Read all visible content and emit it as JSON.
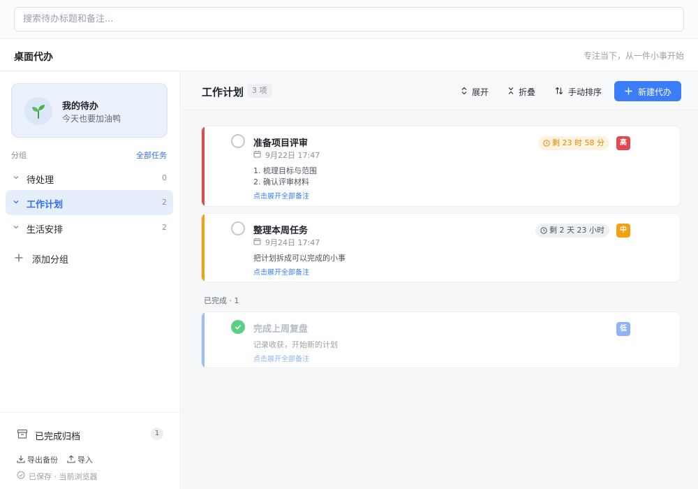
{
  "search": {
    "placeholder": "搜索待办标题和备注...",
    "value": ""
  },
  "app": {
    "title": "桌面代办",
    "slogan": "专注当下，从一件小事开始"
  },
  "sidebar": {
    "profile": {
      "name": "我的待办",
      "subtitle": "今天也要加油鸭",
      "avatar_icon": "sprout-icon"
    },
    "groups_label": "分组",
    "all_tasks_link": "全部任务",
    "groups": [
      {
        "label": "待处理",
        "count": "0",
        "active": false
      },
      {
        "label": "工作计划",
        "count": "2",
        "active": true
      },
      {
        "label": "生活安排",
        "count": "2",
        "active": false
      }
    ],
    "add_group_label": "添加分组",
    "archive": {
      "label": "已完成归档",
      "count": "1"
    },
    "export_label": "导出备份",
    "import_label": "导入",
    "saved_label": "已保存 · 当前浏览器"
  },
  "main": {
    "title": "工作计划",
    "count": "3 项",
    "toolbar": {
      "expand_label": "展开",
      "collapse_label": "折叠",
      "sort_label": "手动排序",
      "new_label": "新建代办"
    },
    "tasks": [
      {
        "title": "准备项目评审",
        "date": "9月22日 17:47",
        "notes": [
          "1. 梳理目标与范围",
          "2. 确认评审材料"
        ],
        "expand_label": "点击展开全部备注",
        "remaining": "剩 23 时 58 分",
        "priority": "高",
        "priority_color": "#e5484d",
        "bar_color": "#e5484d"
      },
      {
        "title": "整理本周任务",
        "date": "9月24日 17:47",
        "notes": [
          "把计划拆成可以完成的小事"
        ],
        "expand_label": "点击展开全部备注",
        "remaining": "剩 2 天 23 小时",
        "priority": "中",
        "priority_color": "#f5a00e",
        "bar_color": "#f5a00e"
      }
    ],
    "completed_label": "已完成 · 1",
    "completed_tasks": [
      {
        "title": "完成上周复盘",
        "notes": [
          "记录收获，开始新的计划"
        ],
        "expand_label": "点击展开全部备注",
        "priority": "低",
        "priority_color": "#8fb3f5",
        "bar_color": "#9dbdf6"
      }
    ]
  },
  "colors": {
    "accent": "#3b7cf7",
    "done_check": "#5bcf86"
  }
}
